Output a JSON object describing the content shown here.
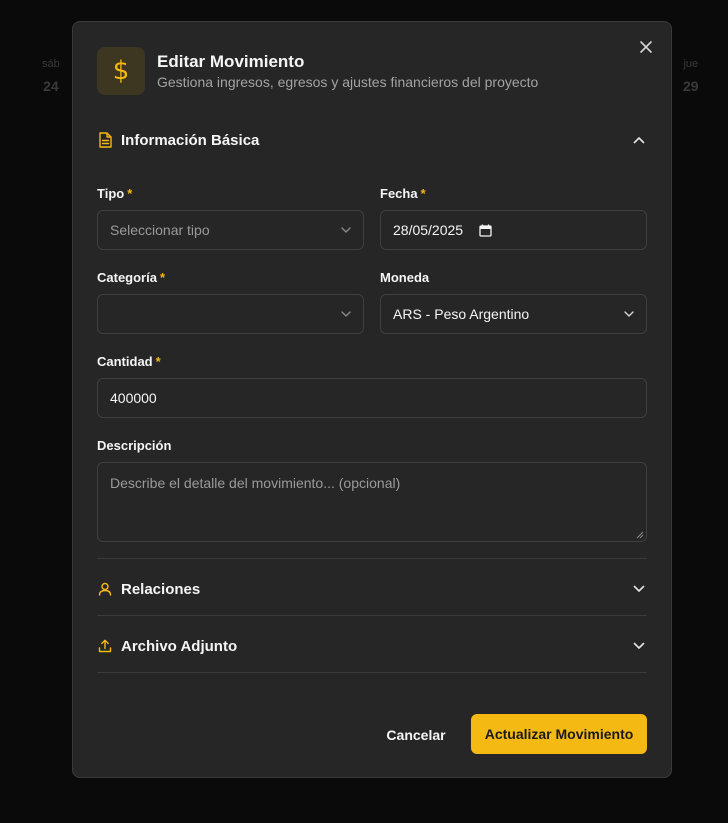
{
  "background": {
    "days": [
      {
        "name": "sáb",
        "number": "24"
      },
      {
        "name": "jue",
        "number": "29"
      }
    ]
  },
  "dialog": {
    "title": "Editar Movimiento",
    "subtitle": "Gestiona ingresos, egresos y ajustes financieros del proyecto",
    "header_icon_glyph": "$",
    "icons": {
      "header": "dollar-icon",
      "close": "close-icon",
      "basic_info": "document-icon",
      "relations": "user-icon",
      "attachment": "upload-icon"
    },
    "accent_color": "#f5b914"
  },
  "sections": {
    "basic_info": {
      "label": "Información Básica",
      "expanded": true
    },
    "relations": {
      "label": "Relaciones",
      "expanded": false
    },
    "attachment": {
      "label": "Archivo Adjunto",
      "expanded": false
    }
  },
  "fields": {
    "tipo": {
      "label": "Tipo",
      "required_mark": "*",
      "placeholder": "Seleccionar tipo",
      "value": ""
    },
    "fecha": {
      "label": "Fecha",
      "required_mark": "*",
      "value": "28/05/2025"
    },
    "categoria": {
      "label": "Categoría",
      "required_mark": "*",
      "value": ""
    },
    "moneda": {
      "label": "Moneda",
      "value": "ARS - Peso Argentino"
    },
    "cantidad": {
      "label": "Cantidad",
      "required_mark": "*",
      "value": "400000"
    },
    "descripcion": {
      "label": "Descripción",
      "placeholder": "Describe el detalle del movimiento... (opcional)",
      "value": ""
    }
  },
  "actions": {
    "cancel_label": "Cancelar",
    "submit_label": "Actualizar Movimiento"
  }
}
